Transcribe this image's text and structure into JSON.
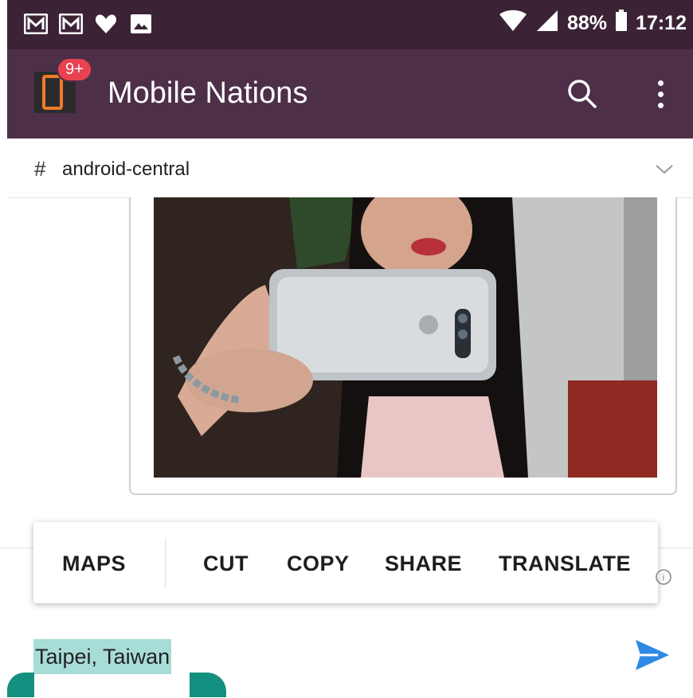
{
  "status_bar": {
    "icons_left": [
      "gmail-icon",
      "gmail-icon",
      "heart-icon",
      "image-icon"
    ],
    "battery": "88%",
    "time": "17:12"
  },
  "app_bar": {
    "badge": "9+",
    "title": "Mobile Nations",
    "actions": [
      "search-icon",
      "more-vertical-icon"
    ]
  },
  "channel": {
    "prefix": "#",
    "name": "android-central"
  },
  "context_menu": {
    "items": [
      "MAPS",
      "CUT",
      "COPY",
      "SHARE",
      "TRANSLATE"
    ]
  },
  "composer": {
    "selected_text": "Taipei, Taiwan"
  },
  "colors": {
    "status_bar": "#3b2335",
    "app_bar": "#4d2f48",
    "badge": "#e8414f",
    "selection": "#a8dcd7",
    "handle": "#13907f",
    "send": "#2d8ae6"
  }
}
